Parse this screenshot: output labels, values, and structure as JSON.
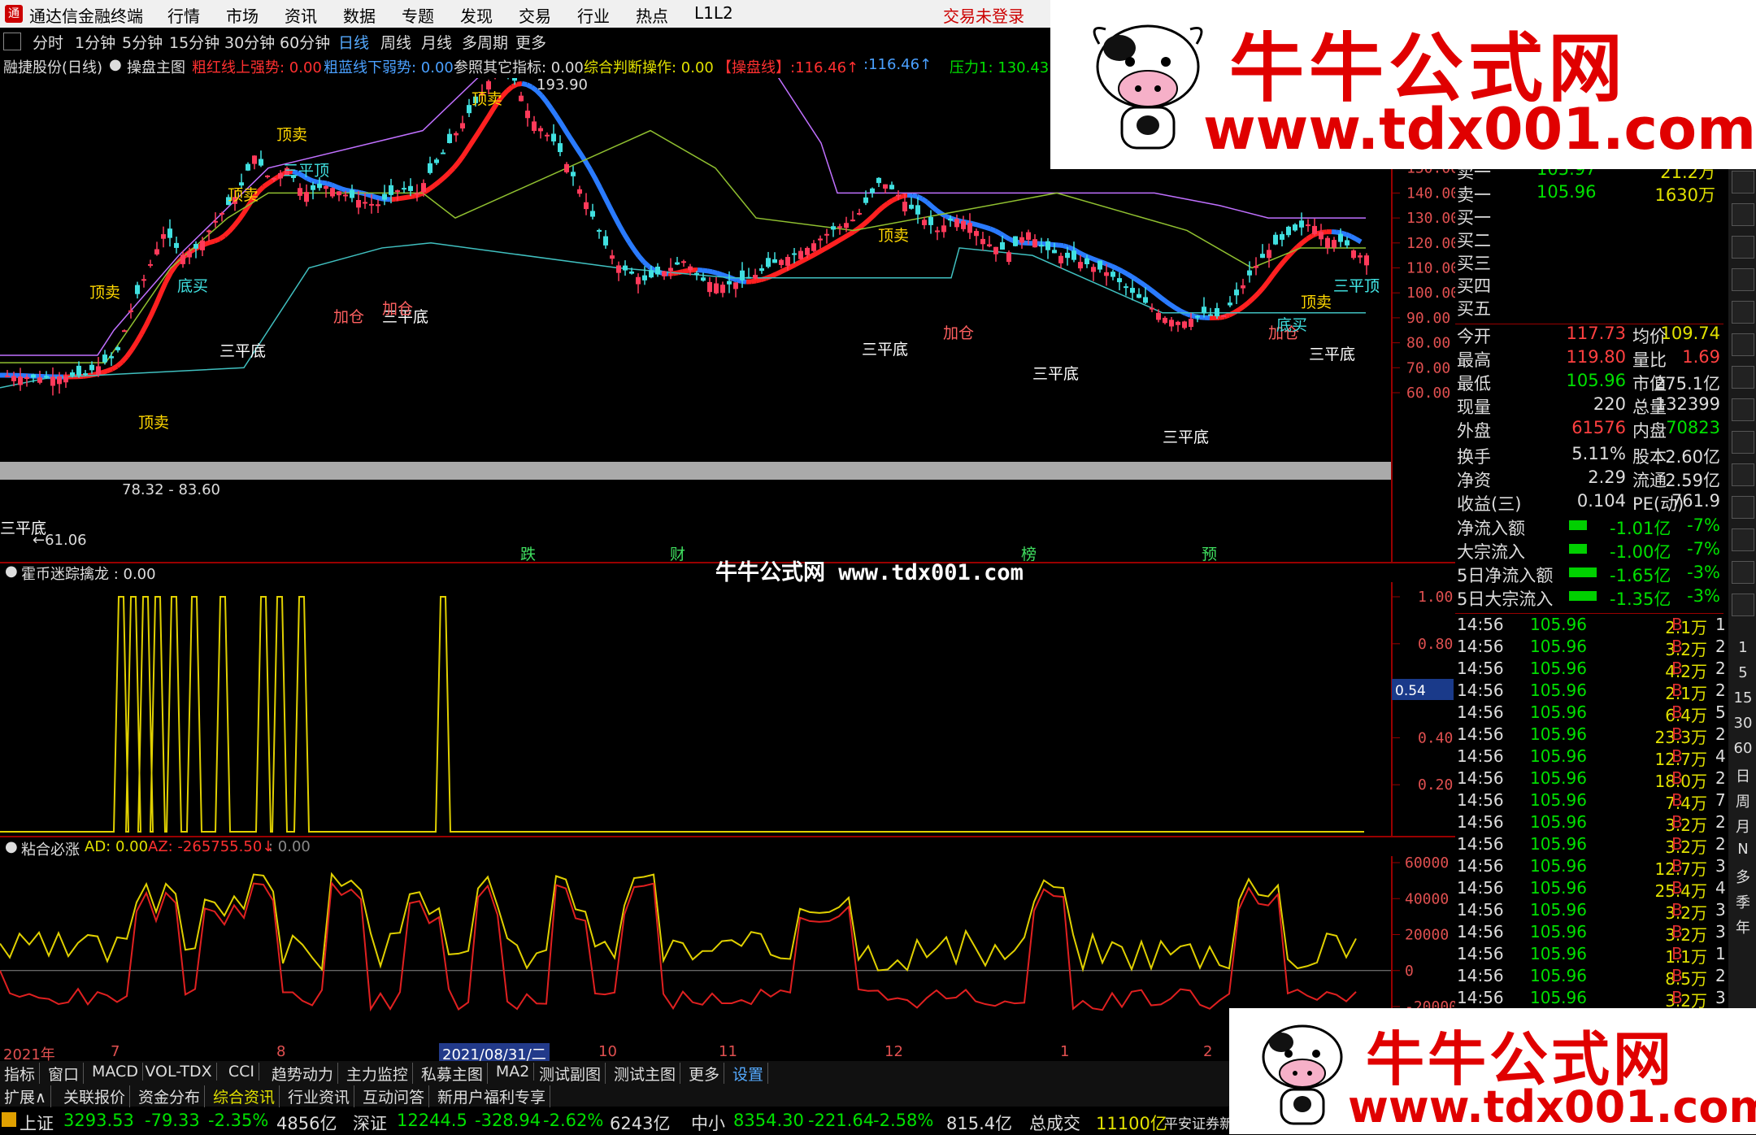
{
  "menubar": {
    "title": "通达信金融终端",
    "items": [
      "行情",
      "市场",
      "资讯",
      "数据",
      "专题",
      "发现",
      "交易",
      "行业",
      "热点",
      "L1L2"
    ],
    "login": "交易未登录"
  },
  "periods": [
    "分时",
    "1分钟",
    "5分钟",
    "15分钟",
    "30分钟",
    "60分钟",
    "日线",
    "周线",
    "月线",
    "多周期",
    "更多"
  ],
  "active_period": "日线",
  "infobar": {
    "stock": "融捷股份(日线)",
    "indicator": "操盘主图",
    "red_label": "粗红线上强势: 0.00",
    "blue_label": "粗蓝线下弱势: 0.00",
    "ref_label": "参照其它指标: 0.00",
    "judge_label": "综合判断操作: 0.00",
    "op_label": "【操盘线】:116.46↑",
    "op_value2": ":116.46↑",
    "pressure": "压力1: 130.43"
  },
  "main_chart": {
    "price_axis": [
      "160.00",
      "150.00",
      "140.00",
      "130.00",
      "120.00",
      "110.00",
      "100.00",
      "90.00",
      "80.00",
      "70.00",
      "60.00"
    ],
    "high_label": "193.90",
    "low_label": "←61.06",
    "range_label": "78.32 - 83.60",
    "signals": [
      {
        "text": "顶卖",
        "kind": "top"
      },
      {
        "text": "顶卖",
        "kind": "top"
      },
      {
        "text": "顶卖",
        "kind": "top"
      },
      {
        "text": "顶卖",
        "kind": "top"
      },
      {
        "text": "顶卖",
        "kind": "top"
      },
      {
        "text": "顶卖",
        "kind": "top"
      },
      {
        "text": "顶卖",
        "kind": "top"
      },
      {
        "text": "三平顶",
        "kind": "flat-top"
      },
      {
        "text": "三平顶",
        "kind": "flat-top"
      },
      {
        "text": "三平顶",
        "kind": "flat-top"
      },
      {
        "text": "三平底",
        "kind": "flat-bottom"
      },
      {
        "text": "三平底",
        "kind": "flat-bottom"
      },
      {
        "text": "三平底",
        "kind": "flat-bottom"
      },
      {
        "text": "三平底",
        "kind": "flat-bottom"
      },
      {
        "text": "三平底",
        "kind": "flat-bottom"
      },
      {
        "text": "三平底",
        "kind": "flat-bottom"
      },
      {
        "text": "三平底",
        "kind": "flat-bottom"
      },
      {
        "text": "加仓",
        "kind": "add"
      },
      {
        "text": "加仓",
        "kind": "add"
      },
      {
        "text": "加仓",
        "kind": "add"
      },
      {
        "text": "加仓",
        "kind": "add"
      },
      {
        "text": "底买",
        "kind": "bottom-buy"
      },
      {
        "text": "底买",
        "kind": "bottom-buy"
      },
      {
        "text": "跌",
        "kind": "tag"
      },
      {
        "text": "财",
        "kind": "tag"
      },
      {
        "text": "榜",
        "kind": "tag"
      },
      {
        "text": "预",
        "kind": "tag"
      }
    ]
  },
  "osc_chart": {
    "title": "霍币迷踪擒龙 : 0.00",
    "axis": [
      "1.00",
      "0.80",
      "0.40",
      "0.20"
    ],
    "current": "0.54"
  },
  "ad_chart": {
    "title": "粘合必涨",
    "ad": "AD: 0.00",
    "az": "AZ: -265755.50↓",
    "extra": ": 0.00",
    "axis": [
      "60000",
      "40000",
      "20000",
      "0",
      "-20000"
    ]
  },
  "date_axis": [
    "2021年",
    "7",
    "8",
    "2021/08/31/二",
    "10",
    "11",
    "12",
    "1",
    "2"
  ],
  "right_panel": {
    "orderbook": [
      {
        "label": "卖一",
        "price": "105.97",
        "vol": "21.2万"
      },
      {
        "label": "卖一",
        "price": "105.96",
        "vol": "1630万"
      },
      {
        "label": "买一",
        "price": "",
        "vol": ""
      },
      {
        "label": "买二",
        "price": "",
        "vol": ""
      },
      {
        "label": "买三",
        "price": "",
        "vol": ""
      },
      {
        "label": "买四",
        "price": "",
        "vol": ""
      },
      {
        "label": "买五",
        "price": "",
        "vol": ""
      }
    ],
    "stats": [
      {
        "l1": "今开",
        "v1": "117.73",
        "c1": "#ff4040",
        "l2": "均价",
        "v2": "109.74",
        "c2": "#e0e000"
      },
      {
        "l1": "最高",
        "v1": "119.80",
        "c1": "#ff4040",
        "l2": "量比",
        "v2": "1.69",
        "c2": "#ff4040"
      },
      {
        "l1": "最低",
        "v1": "105.96",
        "c1": "#00e000",
        "l2": "市值",
        "v2": "275.1亿",
        "c2": "#ddd"
      },
      {
        "l1": "现量",
        "v1": "220",
        "c1": "#ddd",
        "l2": "总量",
        "v2": "132399",
        "c2": "#ddd"
      },
      {
        "l1": "外盘",
        "v1": "61576",
        "c1": "#ff4040",
        "l2": "内盘",
        "v2": "70823",
        "c2": "#00e000"
      },
      {
        "l1": "换手",
        "v1": "5.11%",
        "c1": "#ddd",
        "l2": "股本",
        "v2": "2.60亿",
        "c2": "#ddd"
      },
      {
        "l1": "净资",
        "v1": "2.29",
        "c1": "#ddd",
        "l2": "流通",
        "v2": "2.59亿",
        "c2": "#ddd"
      },
      {
        "l1": "收益(三)",
        "v1": "0.104",
        "c1": "#ddd",
        "l2": "PE(动)",
        "v2": "761.9",
        "c2": "#ddd"
      }
    ],
    "flows": [
      {
        "label": "净流入额",
        "value": "-1.01亿",
        "pct": "-7%"
      },
      {
        "label": "大宗流入",
        "value": "-1.00亿",
        "pct": "-7%"
      },
      {
        "label": "5日净流入额",
        "value": "-1.65亿",
        "pct": "-3%"
      },
      {
        "label": "5日大宗流入",
        "value": "-1.35亿",
        "pct": "-3%"
      }
    ],
    "ticks": [
      {
        "t": "14:56",
        "p": "105.96",
        "v": "2.1万",
        "b": "B",
        "n": "1"
      },
      {
        "t": "14:56",
        "p": "105.96",
        "v": "3.2万",
        "b": "B",
        "n": "2"
      },
      {
        "t": "14:56",
        "p": "105.96",
        "v": "4.2万",
        "b": "B",
        "n": "2"
      },
      {
        "t": "14:56",
        "p": "105.96",
        "v": "2.1万",
        "b": "B",
        "n": "2"
      },
      {
        "t": "14:56",
        "p": "105.96",
        "v": "6.4万",
        "b": "B",
        "n": "5"
      },
      {
        "t": "14:56",
        "p": "105.96",
        "v": "23.3万",
        "b": "B",
        "n": "2"
      },
      {
        "t": "14:56",
        "p": "105.96",
        "v": "12.7万",
        "b": "B",
        "n": "4"
      },
      {
        "t": "14:56",
        "p": "105.96",
        "v": "18.0万",
        "b": "B",
        "n": "2"
      },
      {
        "t": "14:56",
        "p": "105.96",
        "v": "7.4万",
        "b": "B",
        "n": "7"
      },
      {
        "t": "14:56",
        "p": "105.96",
        "v": "3.2万",
        "b": "B",
        "n": "2"
      },
      {
        "t": "14:56",
        "p": "105.96",
        "v": "3.2万",
        "b": "B",
        "n": "2"
      },
      {
        "t": "14:56",
        "p": "105.96",
        "v": "12.7万",
        "b": "B",
        "n": "3"
      },
      {
        "t": "14:56",
        "p": "105.96",
        "v": "25.4万",
        "b": "B",
        "n": "4"
      },
      {
        "t": "14:56",
        "p": "105.96",
        "v": "3.2万",
        "b": "B",
        "n": "3"
      },
      {
        "t": "14:56",
        "p": "105.96",
        "v": "3.2万",
        "b": "B",
        "n": "3"
      },
      {
        "t": "14:56",
        "p": "105.96",
        "v": "1.1万",
        "b": "B",
        "n": "1"
      },
      {
        "t": "14:56",
        "p": "105.96",
        "v": "8.5万",
        "b": "B",
        "n": "2"
      },
      {
        "t": "14:56",
        "p": "105.96",
        "v": "3.2万",
        "b": "B",
        "n": "3"
      }
    ]
  },
  "right_tools": {
    "periods": [
      "1",
      "5",
      "15",
      "30",
      "60",
      "日",
      "周",
      "月",
      "N",
      "多",
      "季",
      "年"
    ]
  },
  "tabs1": [
    "指标",
    "窗口",
    "MACD",
    "VOL-TDX",
    "CCI",
    "趋势动力",
    "主力监控",
    "私募主图",
    "MA2",
    "测试副图",
    "测试主图",
    "更多",
    "设置"
  ],
  "tabs2": [
    "扩展∧",
    "关联报价",
    "资金分布",
    "综合资讯",
    "行业资讯",
    "互动问答",
    "新用户福利专享"
  ],
  "statusbar": {
    "sh_label": "上证",
    "sh_value": "3293.53",
    "sh_change": "-79.33",
    "sh_pct": "-2.35%",
    "sh_amount": "4856亿",
    "sz_label": "深证",
    "sz_value": "12244.5",
    "sz_change": "-328.94",
    "sz_pct": "-2.62%",
    "sz_amount": "6243亿",
    "zx_label": "中小",
    "zx_value": "8354.30",
    "zx_change": "-221.64",
    "zx_pct": "-2.58%",
    "zx_amount": "815.4亿",
    "total_label": "总成交",
    "total_value": "11100亿",
    "broker": "平安证券新"
  },
  "watermark": {
    "brand": "牛牛公式网",
    "url": "www.tdx001.com",
    "mid": "牛牛公式网 www.tdx001.com"
  }
}
